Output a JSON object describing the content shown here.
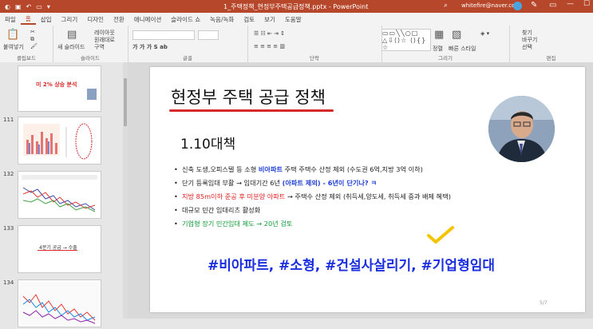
{
  "titlebar": {
    "doc_title": "1_주택정책_현정부주택공급정책.pptx - PowerPoint",
    "account": "whitefire@naver.com",
    "controls": [
      "—",
      "☐",
      "✕"
    ]
  },
  "menu": [
    "파일",
    "홈",
    "삽입",
    "그리기",
    "디자인",
    "전환",
    "애니메이션",
    "슬라이드 쇼",
    "녹음/녹화",
    "검토",
    "보기",
    "도움말"
  ],
  "menu_active_index": 1,
  "ribbon": {
    "groups": [
      "클립보드",
      "슬라이드",
      "글꼴",
      "단락",
      "그리기",
      "편집"
    ],
    "paste": "붙여넣기",
    "new_slide": "새 슬라이드",
    "layout": "레이아웃",
    "reset": "원래대로",
    "section": "구역",
    "arrange": "정렬",
    "quick_styles": "빠른 스타일",
    "find": "찾기",
    "replace": "바꾸기",
    "select": "선택",
    "shapes_glyphs": "▭▭╲╲○□ △⇩⟨⟩☆ ⟨⟩{}☆"
  },
  "thumbnails": [
    {
      "num": "",
      "caption": "미 2% 상승 분석"
    },
    {
      "num": "111",
      "caption": ""
    },
    {
      "num": "132",
      "caption": ""
    },
    {
      "num": "133",
      "caption": "4분기 공급 → 수출"
    },
    {
      "num": "134",
      "caption": ""
    }
  ],
  "slide": {
    "title": "현정부 주택 공급 정책",
    "subtitle": "1.10대책",
    "bullets": [
      {
        "segments": [
          {
            "text": "신축 도생,오피스텔 등 소형 ",
            "style": "normal"
          },
          {
            "text": "비아파트",
            "style": "blue"
          },
          {
            "text": " 주택 주택수 산정 제외 (수도권 6억,지방 3억 이하)",
            "style": "normal"
          }
        ]
      },
      {
        "segments": [
          {
            "text": "단기 등록임대 부활 → 임대기간 6년 ",
            "style": "normal"
          },
          {
            "text": "(아파트 제외) - 6년이 단기나? ㅋ",
            "style": "blue"
          }
        ]
      },
      {
        "segments": [
          {
            "text": "지방 85m이하 준공 후 미분양 아파트",
            "style": "red"
          },
          {
            "text": " → 주택수 산정 제외 (취득세,양도세, 취득세 중과 배제 혜택)",
            "style": "normal"
          }
        ]
      },
      {
        "segments": [
          {
            "text": "대규모 민간 임대리츠 활성화",
            "style": "normal"
          }
        ]
      },
      {
        "segments": [
          {
            "text": "기업형 장기 민간임대 제도 → 20년 검토",
            "style": "green"
          }
        ]
      }
    ],
    "hashtags": "#비아파트, #소형, #건설사살리기, #기업형임대",
    "page_number": "5/7"
  }
}
